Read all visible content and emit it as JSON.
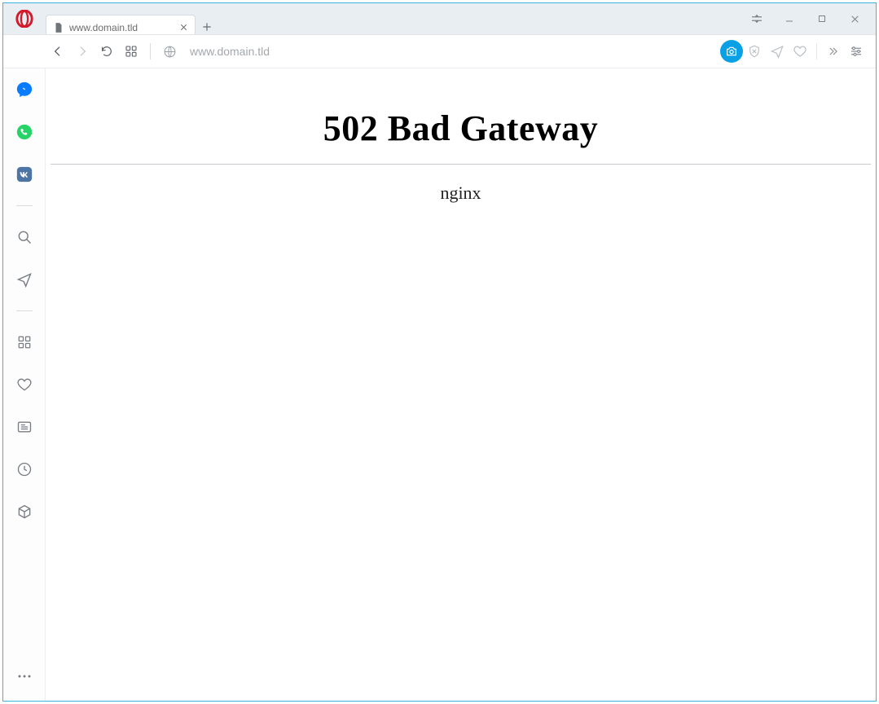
{
  "tab": {
    "title": "www.domain.tld"
  },
  "address": {
    "url": "www.domain.tld"
  },
  "page": {
    "heading": "502 Bad Gateway",
    "server": "nginx"
  },
  "colors": {
    "window_border": "#3eb1e0",
    "accent": "#0aa0e6",
    "messenger": "#0a7cff",
    "whatsapp": "#25d366",
    "vk": "#4c75a3",
    "opera_red": "#d31a2b"
  }
}
